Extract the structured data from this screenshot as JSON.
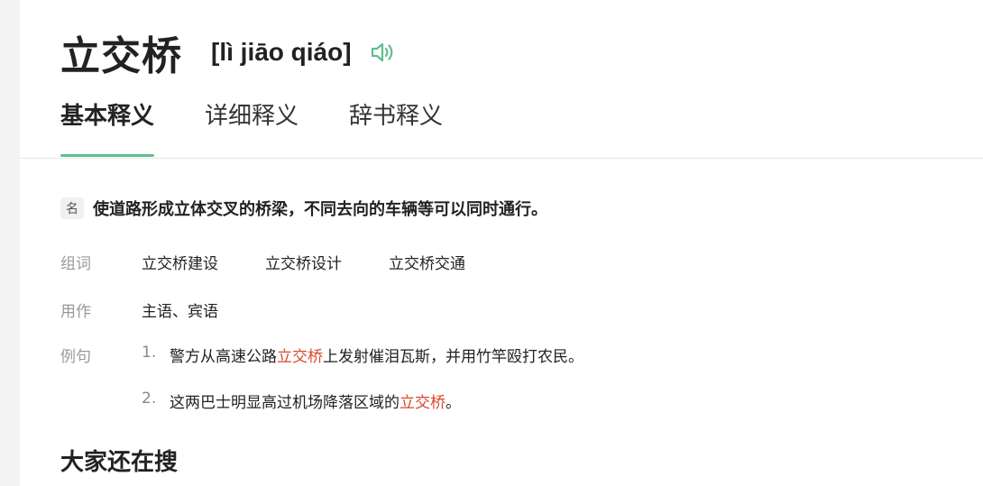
{
  "entry": {
    "word": "立交桥",
    "pinyin": "[lì jiāo qiáo]",
    "speaker_icon": "speaker-icon",
    "accent_color": "#5fbf8c"
  },
  "tabs": [
    {
      "label": "基本释义",
      "active": true
    },
    {
      "label": "详细释义",
      "active": false
    },
    {
      "label": "辞书释义",
      "active": false
    }
  ],
  "definition": {
    "pos": "名",
    "text": "使道路形成立体交叉的桥梁，不同去向的车辆等可以同时通行。"
  },
  "compounds": {
    "label": "组词",
    "items": [
      "立交桥建设",
      "立交桥设计",
      "立交桥交通"
    ]
  },
  "usage": {
    "label": "用作",
    "text": "主语、宾语"
  },
  "examples": {
    "label": "例句",
    "highlight_color": "#d9472b",
    "items": [
      {
        "num": "1.",
        "before": "警方从高速公路",
        "highlight": "立交桥",
        "after": "上发射催泪瓦斯，并用竹竿殴打农民。"
      },
      {
        "num": "2.",
        "before": "这两巴士明显高过机场降落区域的",
        "highlight": "立交桥",
        "after": "。"
      }
    ]
  },
  "related": {
    "title": "大家还在搜"
  }
}
